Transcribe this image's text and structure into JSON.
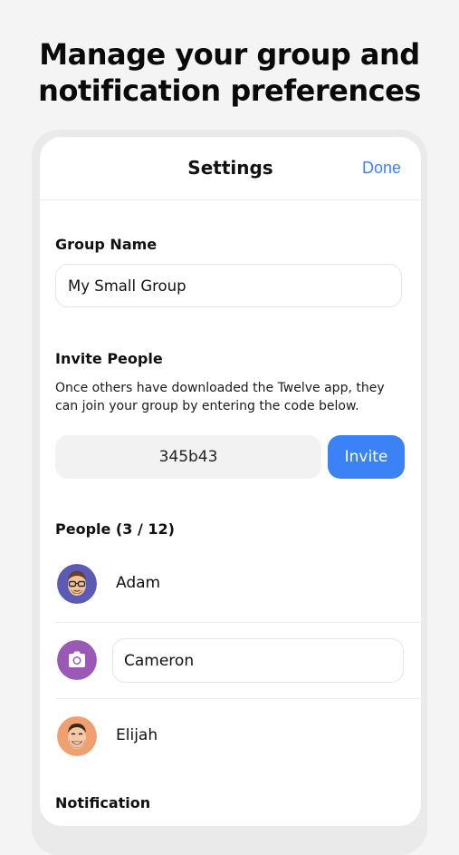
{
  "headline": {
    "line1": "Manage your group and",
    "line2": "notification preferences"
  },
  "nav": {
    "title": "Settings",
    "done_label": "Done"
  },
  "group_name": {
    "label": "Group Name",
    "value": "My Small Group"
  },
  "invite": {
    "label": "Invite People",
    "description": "Once others have downloaded the Twelve app, they can join your group by entering the code below.",
    "code": "345b43",
    "button_label": "Invite"
  },
  "people": {
    "label": "People (3 / 12)",
    "members": [
      {
        "name": "Adam",
        "avatar": "memoji-avatar-glasses",
        "avatar_bg": "#5b5bb5"
      },
      {
        "name": "Cameron",
        "avatar": "camera-icon",
        "avatar_bg": "#9b59b6"
      },
      {
        "name": "Elijah",
        "avatar": "memoji-avatar-smiling",
        "avatar_bg": "#f0a070"
      }
    ]
  },
  "notification": {
    "label": "Notification"
  },
  "colors": {
    "accent": "#3b82f6",
    "page_bg": "#f4f4f4"
  }
}
